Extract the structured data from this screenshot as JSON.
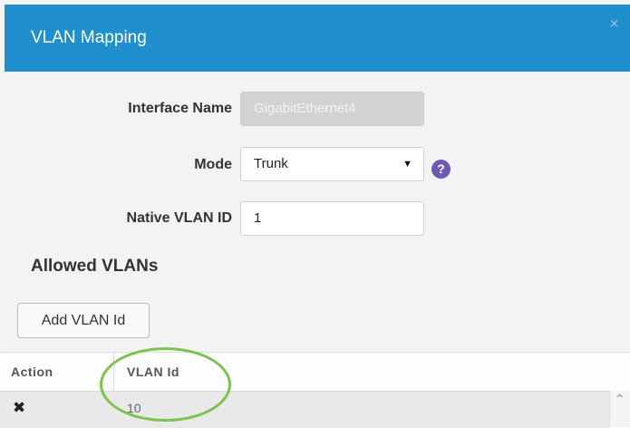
{
  "dialog": {
    "title": "VLAN Mapping",
    "close_glyph": "×"
  },
  "form": {
    "interface_name_label": "Interface Name",
    "interface_name_value": "GigabitEthernet4",
    "mode_label": "Mode",
    "mode_value": "Trunk",
    "mode_arrow": "▼",
    "help_glyph": "?",
    "native_vlan_label": "Native VLAN ID",
    "native_vlan_value": "1"
  },
  "allowed": {
    "section_title": "Allowed VLANs",
    "add_button_label": "Add VLAN Id",
    "table": {
      "columns": [
        "Action",
        "VLAN Id"
      ],
      "rows": [
        {
          "action_icon": "✖",
          "vlan_id": "10"
        }
      ]
    },
    "scroll_up_glyph": "^"
  },
  "colors": {
    "header_bg": "#1f8fce",
    "help_icon_bg": "#6b5bb4",
    "highlight_ring": "#7cc34a"
  }
}
